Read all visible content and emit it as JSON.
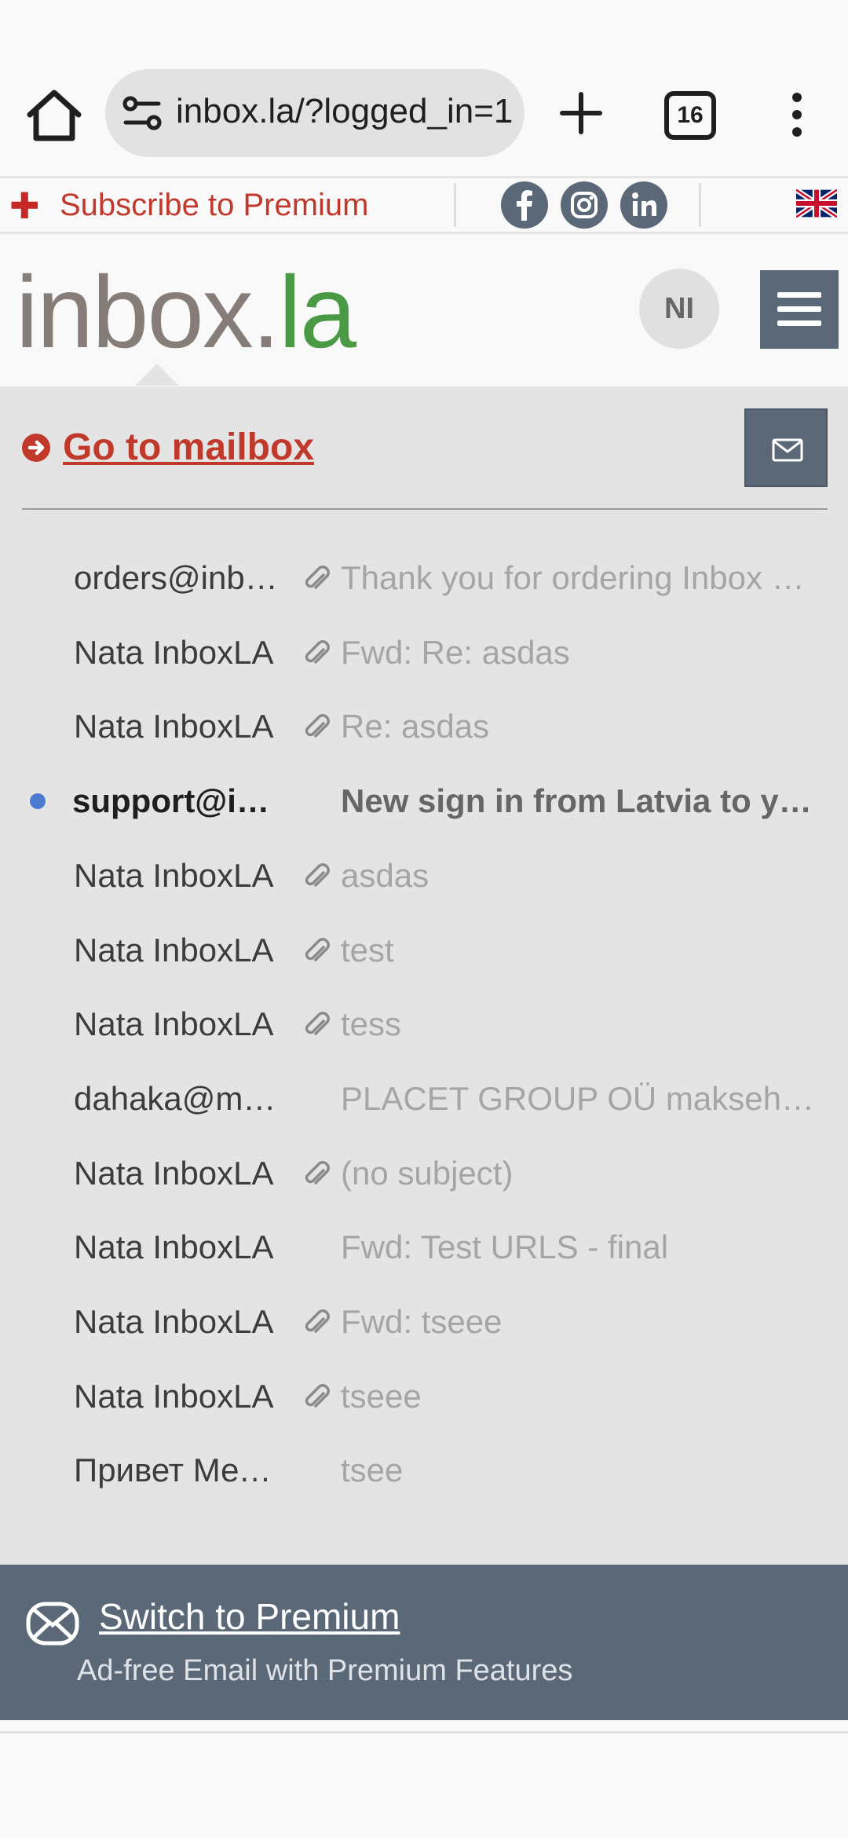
{
  "browser": {
    "url": "inbox.la/?logged_in=1",
    "tab_count": "16"
  },
  "top_strip": {
    "subscribe_label": "Subscribe to Premium",
    "social": [
      "facebook-icon",
      "instagram-icon",
      "linkedin-icon"
    ],
    "language_flag": "uk-flag-icon"
  },
  "header": {
    "logo_main": "inbox.",
    "logo_accent": "la",
    "avatar_initials": "NI"
  },
  "mailbox": {
    "goto_label": "Go to mailbox",
    "messages": [
      {
        "sender": "orders@inbox.la",
        "subject": "Thank you for ordering Inbox Premium",
        "attachment": true,
        "unread": false
      },
      {
        "sender": "Nata InboxLA",
        "subject": "Fwd: Re: asdas",
        "attachment": true,
        "unread": false
      },
      {
        "sender": "Nata InboxLA",
        "subject": "Re: asdas",
        "attachment": true,
        "unread": false
      },
      {
        "sender": "support@inbox.la",
        "subject": "New sign in from Latvia to your account",
        "attachment": false,
        "unread": true
      },
      {
        "sender": "Nata InboxLA",
        "subject": "asdas",
        "attachment": true,
        "unread": false
      },
      {
        "sender": "Nata InboxLA",
        "subject": "test",
        "attachment": true,
        "unread": false
      },
      {
        "sender": "Nata InboxLA",
        "subject": "tess",
        "attachment": true,
        "unread": false
      },
      {
        "sender": "dahaka@mail.ee",
        "subject": "PLACET GROUP OÜ maksehäire",
        "attachment": false,
        "unread": false
      },
      {
        "sender": "Nata InboxLA",
        "subject": "(no subject)",
        "attachment": true,
        "unread": false
      },
      {
        "sender": "Nata InboxLA",
        "subject": "Fwd: Test URLS - final",
        "attachment": false,
        "unread": false
      },
      {
        "sender": "Nata InboxLA",
        "subject": "Fwd: tseee",
        "attachment": true,
        "unread": false
      },
      {
        "sender": "Nata InboxLA",
        "subject": "tseee",
        "attachment": true,
        "unread": false
      },
      {
        "sender": "Привет Медведь",
        "subject": "tsee",
        "attachment": false,
        "unread": false
      }
    ]
  },
  "premium": {
    "title": "Switch to Premium",
    "subtitle": "Ad-free Email with Premium Features"
  },
  "colors": {
    "brand_red": "#c0392b",
    "slate": "#5a6878",
    "logo_gray": "#867d79",
    "logo_green": "#4a9a45",
    "unread_dot": "#4a7bd0"
  }
}
